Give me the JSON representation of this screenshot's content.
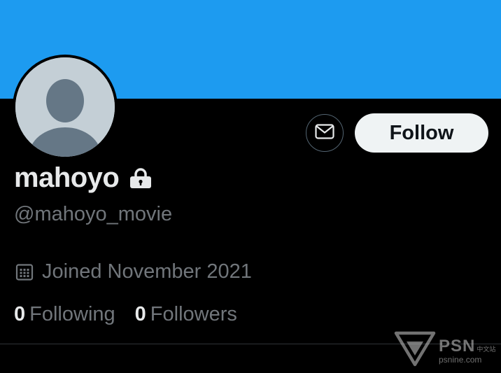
{
  "profile": {
    "display_name": "mahoyo",
    "handle": "@mahoyo_movie",
    "joined": "Joined November 2021",
    "following_count": "0",
    "following_label": "Following",
    "followers_count": "0",
    "followers_label": "Followers"
  },
  "actions": {
    "follow_label": "Follow"
  },
  "icons": {
    "message": "envelope-icon",
    "lock": "lock-icon",
    "calendar": "calendar-icon"
  },
  "watermark": {
    "brand": "PSN",
    "brand_cn": "中文站",
    "url": "psnine.com"
  },
  "colors": {
    "banner": "#1d9bf0",
    "background": "#000000",
    "primary_text": "#e7e9ea",
    "secondary_text": "#71767b",
    "follow_button_bg": "#eff3f4"
  }
}
